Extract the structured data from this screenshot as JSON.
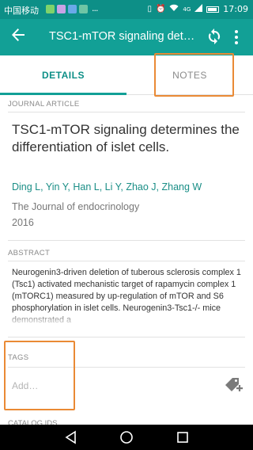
{
  "status_bar": {
    "carrier": "中国移动",
    "dots": "...",
    "network": "4G",
    "time": "17:09"
  },
  "app_bar": {
    "title": "TSC1-mTOR signaling deter…",
    "icons": [
      "back-arrow-icon",
      "sync-icon",
      "more-vert-icon"
    ]
  },
  "tabs": [
    {
      "label": "DETAILS",
      "selected": true
    },
    {
      "label": "NOTES",
      "selected": false
    }
  ],
  "article": {
    "type_label": "JOURNAL ARTICLE",
    "title": "TSC1-mTOR signaling determines the differentiation of islet cells.",
    "authors": "Ding L, Yin Y, Han L, Li Y, Zhao J, Zhang W",
    "journal": "The Journal of endocrinology",
    "year": "2016"
  },
  "abstract": {
    "label": "ABSTRACT",
    "text": "Neurogenin3-driven deletion of tuberous sclerosis complex 1 (Tsc1) activated mechanistic target of rapamycin complex 1 (mTORC1) measured by up-regulation of mTOR and S6 phosphorylation in islet cells. Neurogenin3-Tsc1-/- mice demonstrated a"
  },
  "tags": {
    "label": "TAGS",
    "placeholder": "Add…",
    "icon": "add-tag-icon"
  },
  "catalog": {
    "label": "CATALOG IDS"
  },
  "colors": {
    "primary": "#12a096",
    "primary_dark": "#0d8f87",
    "highlight": "#ea8a35"
  }
}
